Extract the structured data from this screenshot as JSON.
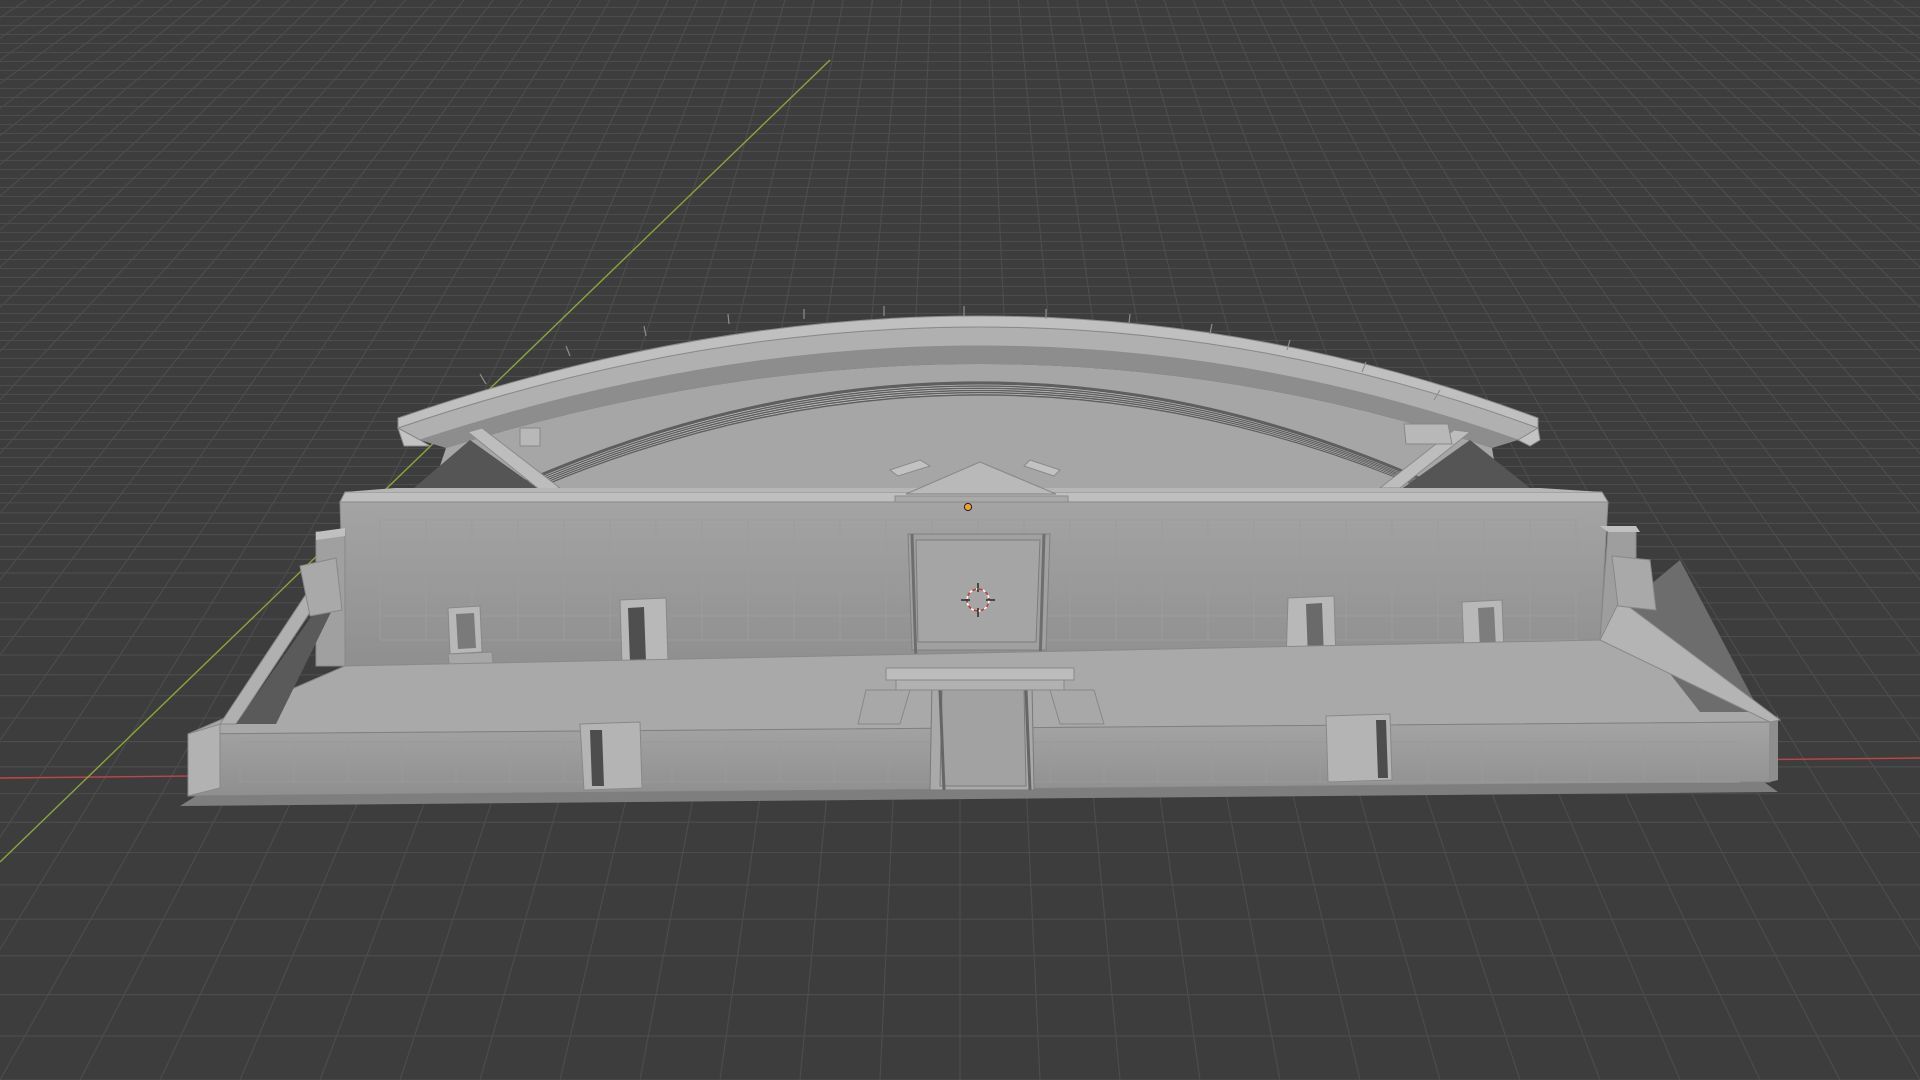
{
  "viewport": {
    "background_color": "#3d3d3d",
    "grid_color": "#4c4c4c",
    "x_axis_color": "#c0454b",
    "y_axis_color": "#8aa53a",
    "model_color": "#9a9a9a"
  },
  "scene": {
    "object_origin_icon": "origin-dot-icon",
    "cursor_icon": "3d-cursor-icon",
    "model": "amphitheater-mesh"
  }
}
